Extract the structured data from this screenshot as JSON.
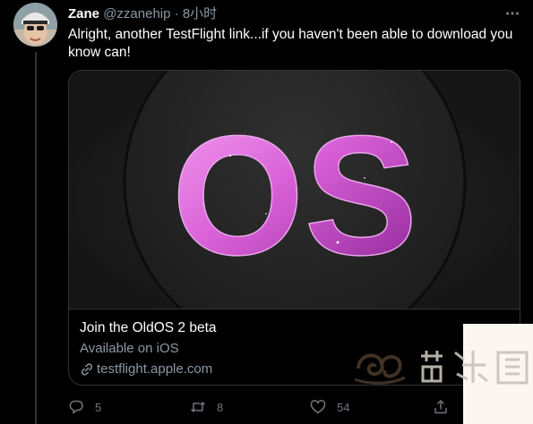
{
  "tweet": {
    "author_name": "Zane",
    "handle": "@zzanehip",
    "separator": "·",
    "time": "8小时",
    "text": "Alright, another TestFlight link...if you haven't been able to download you know can!"
  },
  "card": {
    "image_text": "OS",
    "title": "Join the OldOS 2 beta",
    "subtitle": "Available on iOS",
    "link": "testflight.apple.com"
  },
  "actions": {
    "reply_count": "5",
    "retweet_count": "8",
    "like_count": "54"
  },
  "icons": {
    "more": "more-icon",
    "reply": "reply-icon",
    "retweet": "retweet-icon",
    "like": "heart-icon",
    "share": "share-icon",
    "link": "link-icon"
  },
  "colors": {
    "background": "#000000",
    "text_primary": "#ffffff",
    "text_secondary": "#8b98a5",
    "border": "#2f3336",
    "os_gradient_start": "#f07cf0",
    "os_gradient_end": "#9d2fa8"
  }
}
